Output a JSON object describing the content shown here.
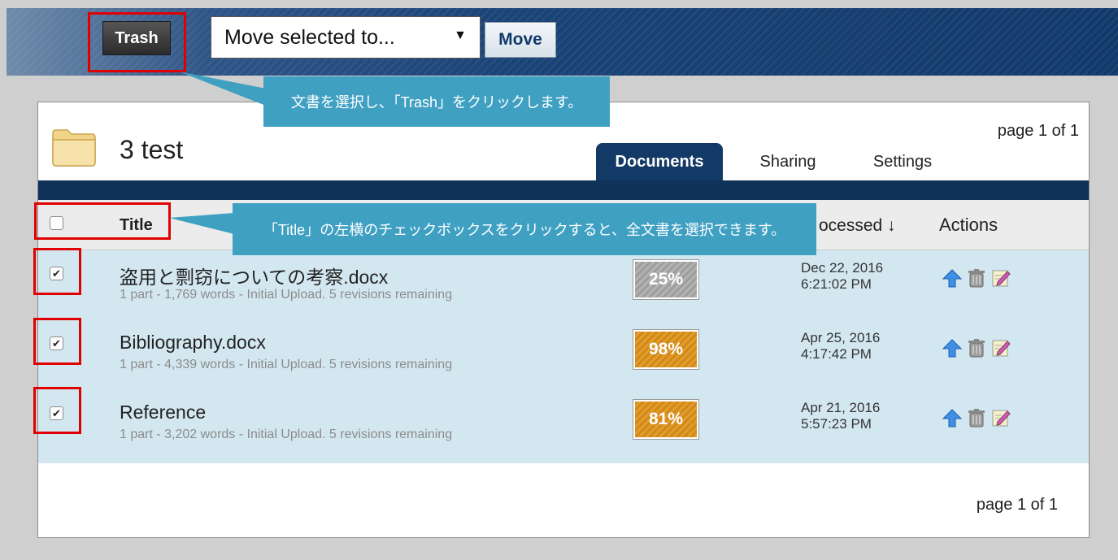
{
  "toolbar": {
    "trash_label": "Trash",
    "move_select_value": "Move selected to...",
    "move_label": "Move"
  },
  "callouts": {
    "trash_hint": "文書を選択し、「Trash」をクリックします。",
    "title_hint": "「Title」の左横のチェックボックスをクリックすると、全文書を選択できます。"
  },
  "folder": {
    "name": "3 test",
    "page_info_top": "page 1 of 1",
    "page_info_bottom": "page 1 of 1"
  },
  "tabs": {
    "documents": "Documents",
    "sharing": "Sharing",
    "settings": "Settings"
  },
  "table": {
    "title_header": "Title",
    "processed_header": "ocessed ↓",
    "actions_header": "Actions",
    "rows": [
      {
        "name": "盗用と剽窃についての考察.docx",
        "meta": "1 part - 1,769 words - Initial Upload. 5 revisions remaining",
        "score": "25%",
        "date": "Dec 22, 2016",
        "time": "6:21:02 PM",
        "checked": true
      },
      {
        "name": "Bibliography.docx",
        "meta": "1 part - 4,339 words - Initial Upload. 5 revisions remaining",
        "score": "98%",
        "date": "Apr 25, 2016",
        "time": "4:17:42 PM",
        "checked": true
      },
      {
        "name": "Reference",
        "meta": "1 part - 3,202 words - Initial Upload. 5 revisions remaining",
        "score": "81%",
        "date": "Apr 21, 2016",
        "time": "5:57:23 PM",
        "checked": true
      }
    ]
  },
  "colors": {
    "highlight": "#e00000",
    "callout": "#3fa0c2",
    "row_background": "#d3e7f1",
    "score_low": "#a6a6a6",
    "score_high": "#d8901f"
  },
  "icons": {
    "move_up": "arrow-up-icon",
    "delete": "trash-icon",
    "edit": "edit-icon",
    "folder": "folder-icon"
  }
}
